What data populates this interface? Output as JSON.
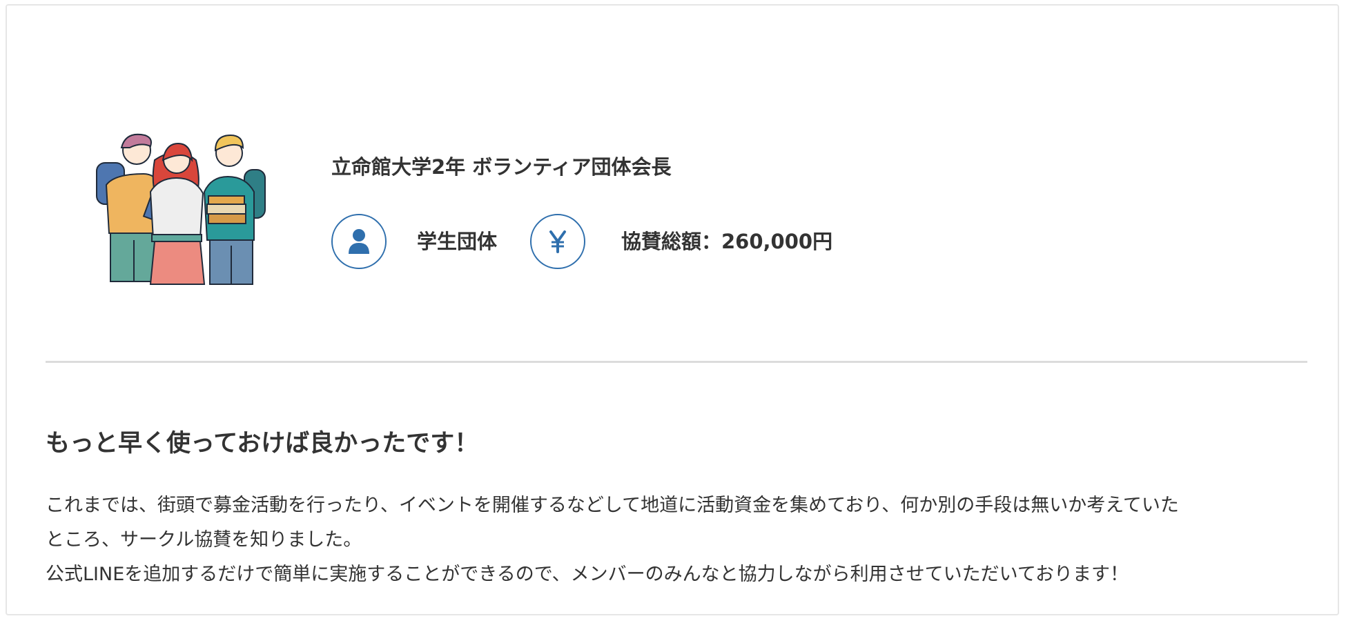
{
  "testimonial": {
    "role": "立命館大学2年 ボランティア団体会長",
    "type": {
      "icon": "person-icon",
      "label": "学生団体"
    },
    "sponsorship": {
      "icon": "yen-icon",
      "label": "協賛総額：260,000円"
    },
    "headline": "もっと早く使っておけば良かったです！",
    "body": [
      "これまでは、街頭で募金活動を行ったり、イベントを開催するなどして地道に活動資金を集めており、何か別の手段は無いか考えていた",
      "ところ、サークル協賛を知りました。",
      "公式LINEを追加するだけで簡単に実施することができるので、メンバーのみんなと協力しながら利用させていただいております！"
    ]
  },
  "colors": {
    "accent": "#2f6fad",
    "text": "#333333",
    "divider": "#dcdcdc"
  },
  "illustration": {
    "icon": "students-illustration"
  }
}
